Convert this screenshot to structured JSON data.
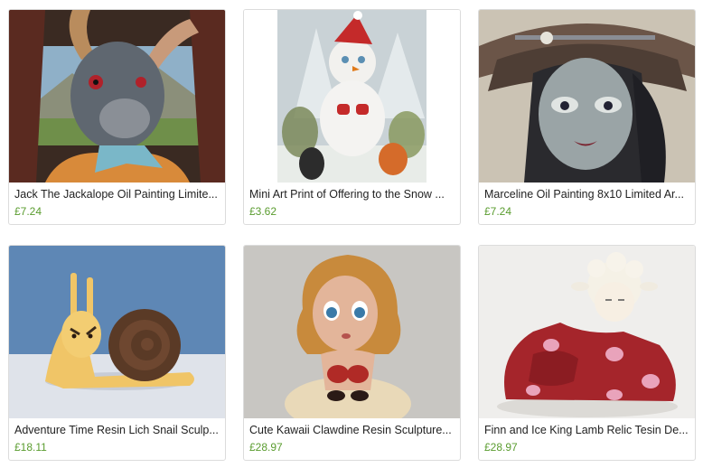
{
  "listings": [
    {
      "title": "Jack The Jackalope Oil Painting Limite...",
      "price": "£7.24"
    },
    {
      "title": "Mini Art Print of Offering to the Snow ...",
      "price": "£3.62"
    },
    {
      "title": "Marceline Oil Painting 8x10 Limited Ar...",
      "price": "£7.24"
    },
    {
      "title": "Adventure Time Resin Lich Snail Sculp...",
      "price": "£18.11"
    },
    {
      "title": "Cute Kawaii Clawdine Resin Sculpture...",
      "price": "£28.97"
    },
    {
      "title": "Finn and Ice King Lamb Relic Tesin De...",
      "price": "£28.97"
    }
  ],
  "colors": {
    "price": "#5a9c2f",
    "border": "#dcdcdc"
  }
}
